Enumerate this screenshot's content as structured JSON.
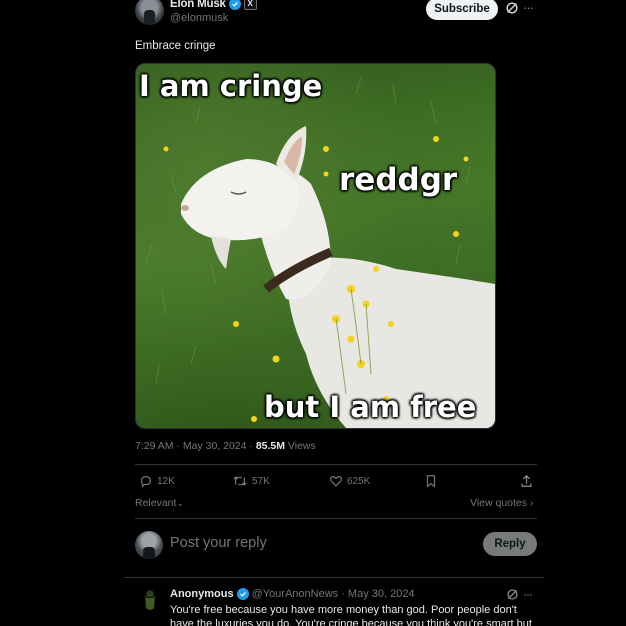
{
  "post": {
    "author_name": "Elon Musk",
    "author_handle": "@elonmusk",
    "org_badge": "X",
    "subscribe_label": "Subscribe",
    "more_label": "···",
    "text": "Embrace cringe",
    "meme": {
      "caption_top": "I am cringe",
      "watermark": "reddgr",
      "caption_bottom": "but I am free"
    },
    "time": "7:29 AM · May 30, 2024 · ",
    "views_count": "85.5M",
    "views_label": " Views"
  },
  "actions": {
    "replies": "12K",
    "reposts": "57K",
    "likes": "625K"
  },
  "sort": {
    "label": "Relevant",
    "chevron": "⌄",
    "view_quotes": "View quotes ›"
  },
  "composer": {
    "placeholder": "Post your reply",
    "reply_label": "Reply"
  },
  "reply": {
    "author_name": "Anonymous",
    "author_handle": "@YourAnonNews · May 30, 2024",
    "more_label": "···",
    "text": "You're free because you have more money than god. Poor people don't have the luxuries you do. You're cringe because you think you're smart but"
  },
  "colors": {
    "accent": "#1d9bf0",
    "muted": "#71767b",
    "text": "#e7e9ea",
    "divider": "#2f3336"
  }
}
